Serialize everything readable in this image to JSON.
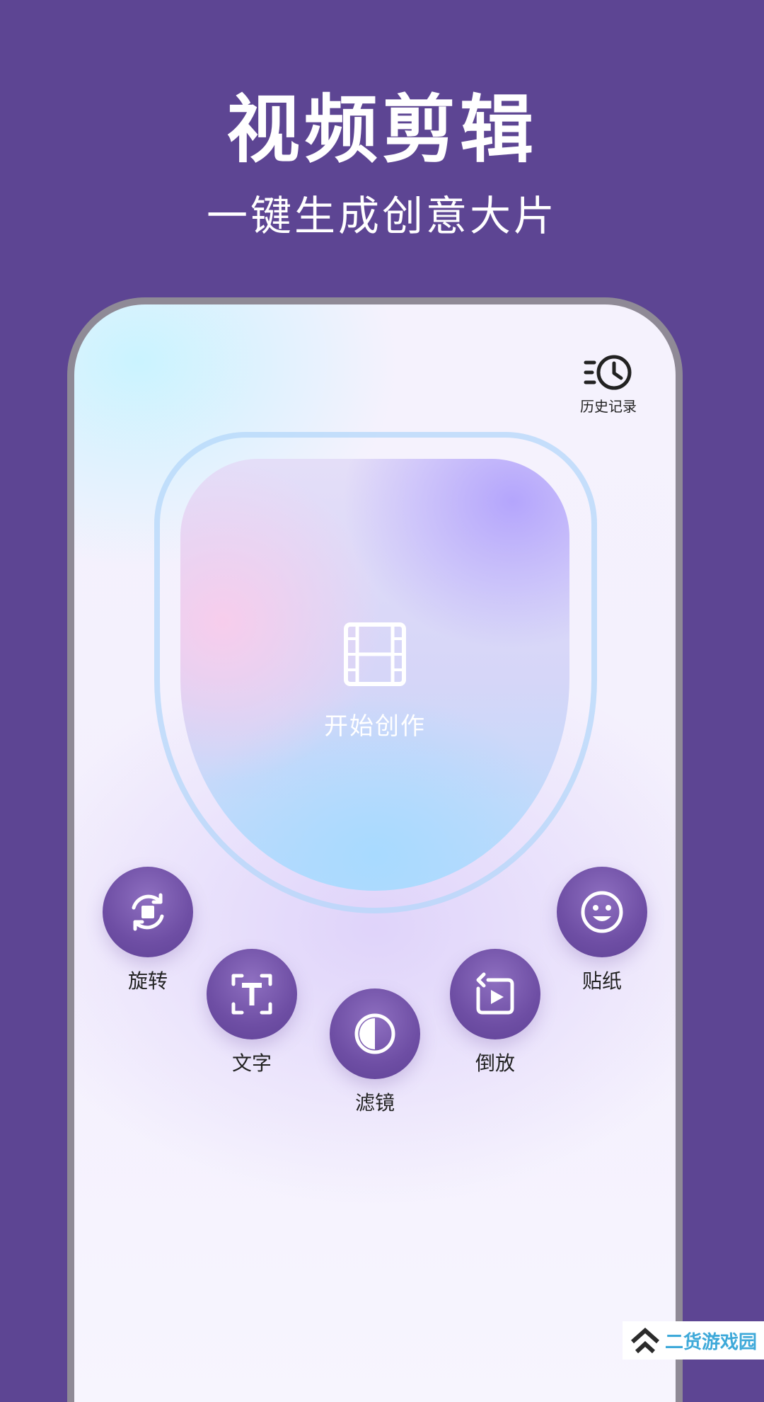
{
  "promo": {
    "title": "视频剪辑",
    "subtitle": "一键生成创意大片"
  },
  "header": {
    "history_label": "历史记录",
    "history_icon": "history-clock-icon"
  },
  "create": {
    "label": "开始创作",
    "icon": "film-strip-icon"
  },
  "tools": [
    {
      "label": "旋转",
      "icon": "rotate-icon"
    },
    {
      "label": "文字",
      "icon": "text-icon"
    },
    {
      "label": "滤镜",
      "icon": "filter-icon"
    },
    {
      "label": "倒放",
      "icon": "reverse-play-icon"
    },
    {
      "label": "贴纸",
      "icon": "sticker-smiley-icon"
    }
  ],
  "watermark": {
    "text": "二货游戏园"
  },
  "colors": {
    "background": "#5d4593",
    "tool_button": "#6e4ea4",
    "accent_ring": "#b4d7fa"
  }
}
